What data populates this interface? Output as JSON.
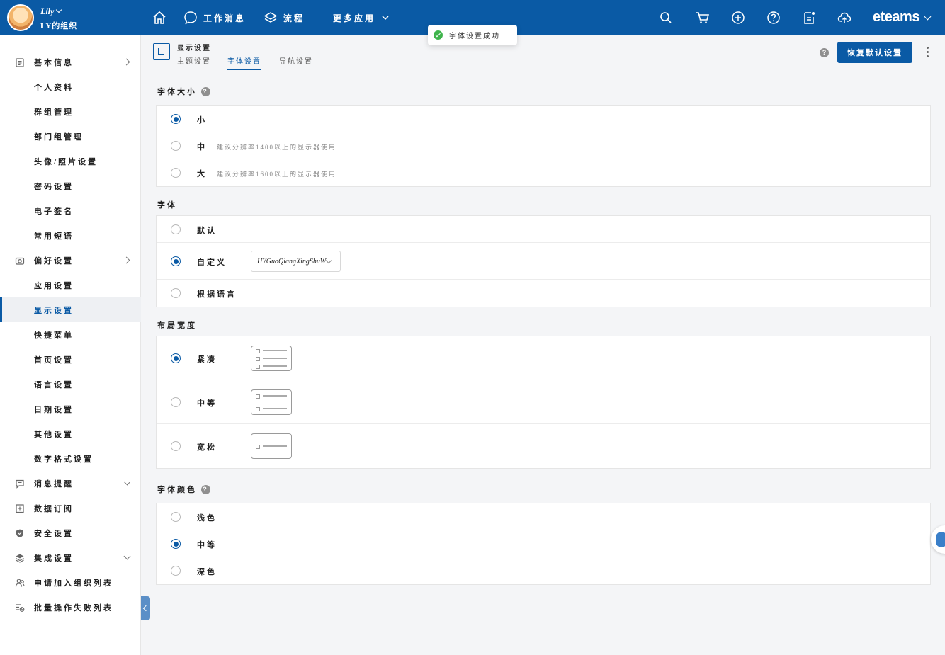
{
  "header": {
    "user_name": "Lily",
    "org_name": "LY的组织",
    "nav": [
      {
        "label": ""
      },
      {
        "label": "工作消息"
      },
      {
        "label": "流程"
      },
      {
        "label": "更多应用"
      }
    ],
    "brand": "eteams",
    "icons": [
      "home-icon",
      "chat-icon",
      "layers-icon",
      "search-icon",
      "cart-icon",
      "plus-circle-icon",
      "help-icon",
      "tasks-icon",
      "cloud-upload-icon"
    ]
  },
  "toast": {
    "message": "字体设置成功"
  },
  "sidebar": {
    "items": [
      {
        "label": "基本信息",
        "type": "parent",
        "icon": "clipboard-icon",
        "arrow": "right"
      },
      {
        "label": "个人资料",
        "type": "child"
      },
      {
        "label": "群组管理",
        "type": "child"
      },
      {
        "label": "部门组管理",
        "type": "child"
      },
      {
        "label": "头像/照片设置",
        "type": "child"
      },
      {
        "label": "密码设置",
        "type": "child"
      },
      {
        "label": "电子签名",
        "type": "child"
      },
      {
        "label": "常用短语",
        "type": "child"
      },
      {
        "label": "偏好设置",
        "type": "parent",
        "icon": "camera-icon",
        "arrow": "right"
      },
      {
        "label": "应用设置",
        "type": "child"
      },
      {
        "label": "显示设置",
        "type": "child",
        "active": true
      },
      {
        "label": "快捷菜单",
        "type": "child"
      },
      {
        "label": "首页设置",
        "type": "child"
      },
      {
        "label": "语言设置",
        "type": "child"
      },
      {
        "label": "日期设置",
        "type": "child"
      },
      {
        "label": "其他设置",
        "type": "child"
      },
      {
        "label": "数字格式设置",
        "type": "child"
      },
      {
        "label": "消息提醒",
        "type": "parent",
        "icon": "message-icon",
        "arrow": "down"
      },
      {
        "label": "数据订阅",
        "type": "parent",
        "icon": "subscribe-icon"
      },
      {
        "label": "安全设置",
        "type": "parent",
        "icon": "shield-icon"
      },
      {
        "label": "集成设置",
        "type": "parent",
        "icon": "stack-icon",
        "arrow": "down"
      },
      {
        "label": "申请加入组织列表",
        "type": "parent",
        "icon": "users-icon"
      },
      {
        "label": "批量操作失败列表",
        "type": "parent",
        "icon": "list-error-icon"
      }
    ]
  },
  "page": {
    "title": "显示设置",
    "tabs": [
      "主题设置",
      "字体设置",
      "导航设置"
    ],
    "active_tab": 1,
    "restore_button": "恢复默认设置",
    "help_char": "?"
  },
  "font_size": {
    "title": "字体大小",
    "options": [
      {
        "label": "小",
        "hint": "",
        "selected": true
      },
      {
        "label": "中",
        "hint": "建议分辨率1400以上的显示器使用",
        "selected": false
      },
      {
        "label": "大",
        "hint": "建议分辨率1600以上的显示器使用",
        "selected": false
      }
    ]
  },
  "font_family": {
    "title": "字体",
    "options": [
      {
        "label": "默认",
        "selected": false
      },
      {
        "label": "自定义",
        "selected": true
      },
      {
        "label": "根据语言",
        "selected": false
      }
    ],
    "custom_value": "HYGuoQiangXingShuW"
  },
  "layout_width": {
    "title": "布局宽度",
    "options": [
      {
        "label": "紧凑",
        "selected": true
      },
      {
        "label": "中等",
        "selected": false
      },
      {
        "label": "宽松",
        "selected": false
      }
    ]
  },
  "font_color": {
    "title": "字体颜色",
    "options": [
      {
        "label": "浅色",
        "selected": false
      },
      {
        "label": "中等",
        "selected": true
      },
      {
        "label": "深色",
        "selected": false
      }
    ]
  },
  "colors": {
    "primary": "#0a5aa5",
    "success": "#3fb44c"
  }
}
